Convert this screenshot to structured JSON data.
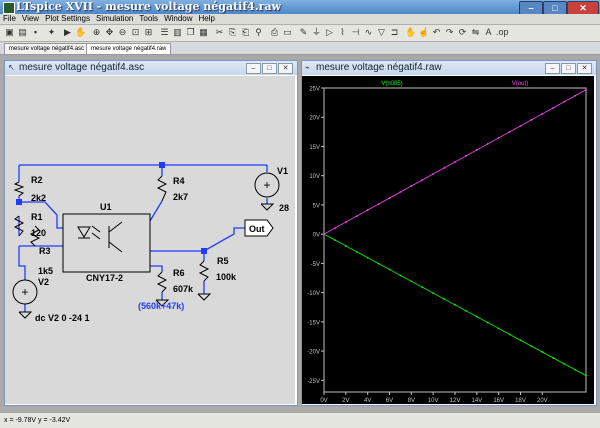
{
  "app": {
    "title": "LTspice XVII - mesure voltage négatif4.raw"
  },
  "window_controls": {
    "minimize": "–",
    "maximize": "□",
    "close": "✕"
  },
  "menu": [
    "File",
    "View",
    "Plot Settings",
    "Simulation",
    "Tools",
    "Window",
    "Help"
  ],
  "tabs": [
    {
      "label": "mesure voltage négatif4.asc"
    },
    {
      "label": "mesure voltage négatif4.raw"
    }
  ],
  "schematic_window": {
    "title": "mesure voltage négatif4.asc"
  },
  "waveform_window": {
    "title": "mesure voltage négatif4.raw"
  },
  "schematic": {
    "R2": {
      "name": "R2",
      "value": "2k2"
    },
    "R1": {
      "name": "R1",
      "value": "120"
    },
    "R3": {
      "name": "R3",
      "value": "1k5"
    },
    "V2": {
      "name": "V2",
      "value": "dc V2 0 -24 1"
    },
    "U1": {
      "name": "U1",
      "value": "CNY17-2"
    },
    "R4": {
      "name": "R4",
      "value": "2k7"
    },
    "R6": {
      "name": "R6",
      "value": "607k",
      "note": "(560k+47k)"
    },
    "R5": {
      "name": "R5",
      "value": "100k"
    },
    "V1": {
      "name": "V1",
      "value": "28"
    },
    "out_label": "Out"
  },
  "chart_data": {
    "type": "line",
    "series": [
      {
        "name": "V(n005)",
        "color": "#00ff00",
        "x": [
          0,
          24
        ],
        "y": [
          0,
          -24.2
        ]
      },
      {
        "name": "V(out)",
        "color": "#ff44ff",
        "x": [
          0,
          24
        ],
        "y": [
          0,
          24.7
        ]
      }
    ],
    "xlim": [
      0,
      24
    ],
    "ylim": [
      -27,
      25
    ],
    "x_ticks": [
      "0V",
      "2V",
      "4V",
      "6V",
      "8V",
      "10V",
      "12V",
      "14V",
      "16V",
      "18V",
      "20V"
    ],
    "y_ticks": [
      "25V",
      "20V",
      "15V",
      "10V",
      "5V",
      "0V",
      "-5V",
      "-10V",
      "-15V",
      "-20V",
      "-25V"
    ],
    "grid": false,
    "legend": "top"
  },
  "status": {
    "text": "x = -9.78V   y = -3.42V"
  }
}
